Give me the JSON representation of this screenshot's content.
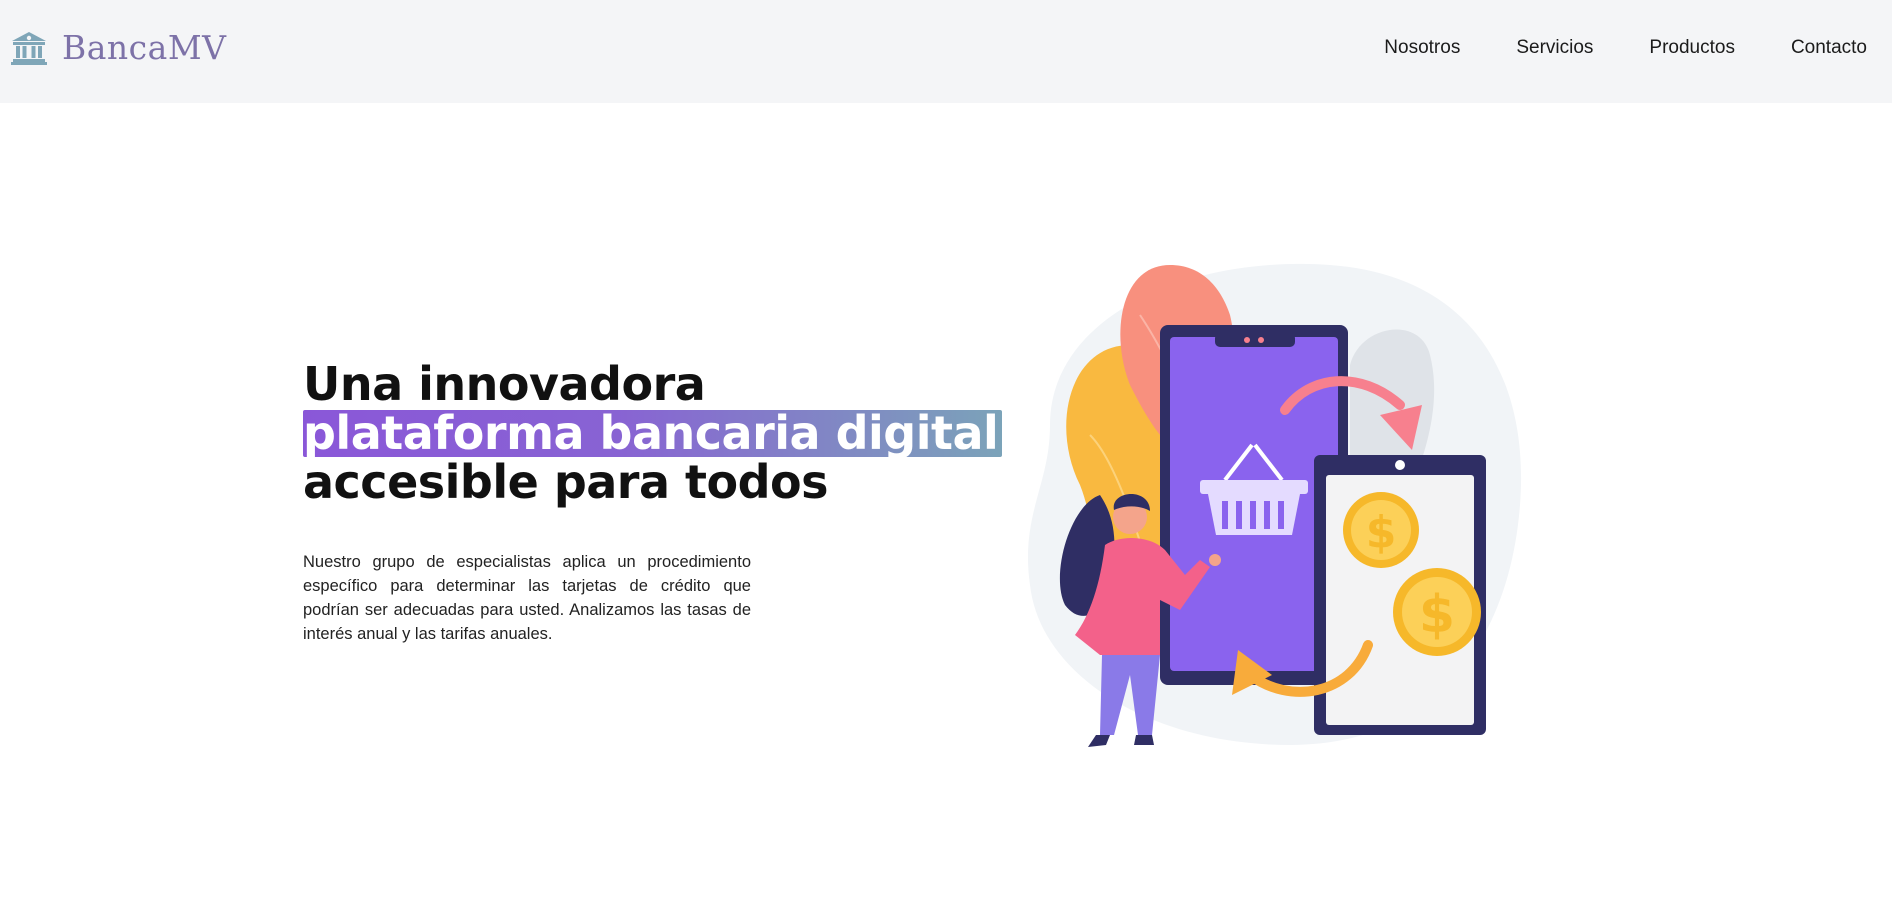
{
  "brand": {
    "name": "BancaMV",
    "icon": "bank-icon",
    "color": "#7d72a8"
  },
  "nav": {
    "items": [
      {
        "label": "Nosotros"
      },
      {
        "label": "Servicios"
      },
      {
        "label": "Productos"
      },
      {
        "label": "Contacto"
      }
    ]
  },
  "hero": {
    "title_line1": "Una innovadora",
    "title_highlight": "plataforma bancaria digital",
    "title_line3": "accesible para todos",
    "description": "Nuestro grupo de especialistas aplica un procedimiento específico para determinar las tarjetas de crédito que podrían ser adecuadas para usted. Analizamos las tasas de interés anual y las tarifas anuales.",
    "highlight_gradient": [
      "#8a57d8",
      "#7ba3b9"
    ]
  },
  "illustration": {
    "icon": "mobile-banking-illustration",
    "colors": {
      "phone": "#2f2e64",
      "screen": "#8a63ee",
      "coin": "#f6b82a",
      "arrow_pink": "#f7808e",
      "arrow_orange": "#f8ab3b",
      "woman_top": "#f3618a",
      "woman_pants": "#8a7ae8"
    }
  }
}
